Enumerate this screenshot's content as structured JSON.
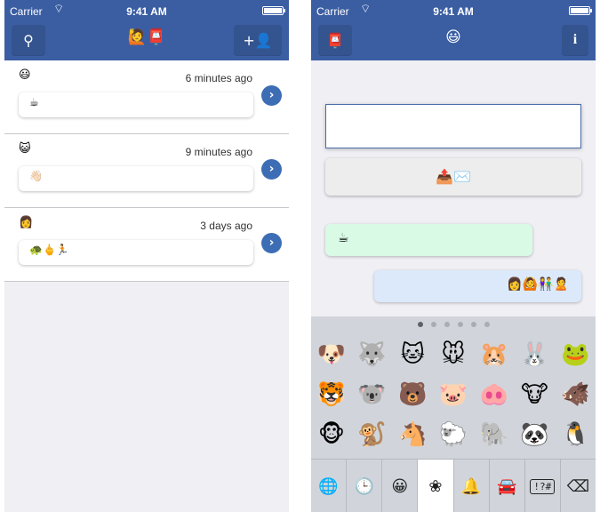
{
  "status_bar": {
    "carrier": "Carrier",
    "time": "9:41 AM"
  },
  "left_nav": {
    "tools_glyph": "⚲",
    "center_title": "🙋📮",
    "add_contact_glyph": "+👤"
  },
  "conversations": [
    {
      "avatar": "😃",
      "time": "6 minutes ago",
      "preview": "☕"
    },
    {
      "avatar": "😺",
      "time": "9 minutes ago",
      "preview": "👋🏻"
    },
    {
      "avatar": "👩",
      "time": "3 days ago",
      "preview": "🐢🖕🏃"
    }
  ],
  "chevron_glyph": "›",
  "right_nav": {
    "inbox_glyph": "📮",
    "center_title": "😃",
    "info_label": "i"
  },
  "compose": {
    "value": "",
    "placeholder": ""
  },
  "send_button_label": "📤✉️",
  "messages": [
    {
      "direction": "in",
      "text": "☕"
    },
    {
      "direction": "out",
      "text": "👩🙆👫🙎"
    }
  ],
  "keyboard": {
    "pages": 6,
    "active_page": 1,
    "emoji": [
      "🐶",
      "🐺",
      "🐱",
      "🐭",
      "🐹",
      "🐰",
      "🐸",
      "🐯",
      "🐨",
      "🐻",
      "🐷",
      "🐽",
      "🐮",
      "🐗",
      "🐵",
      "🐒",
      "🐴",
      "🐑",
      "🐘",
      "🐼",
      "🐧"
    ],
    "bar": [
      {
        "name": "globe",
        "glyph": "🌐"
      },
      {
        "name": "recent",
        "glyph": "🕒"
      },
      {
        "name": "smileys",
        "glyph": "😀"
      },
      {
        "name": "nature",
        "glyph": "❀"
      },
      {
        "name": "objects",
        "glyph": "🔔"
      },
      {
        "name": "places",
        "glyph": "🚘"
      },
      {
        "name": "symbols",
        "glyph": "!?#"
      },
      {
        "name": "delete",
        "glyph": "⌫"
      }
    ],
    "selected": "nature"
  },
  "colors": {
    "navbar": "#3b5ea3",
    "accent": "#3d6db5",
    "bubble_in": "#d9fbe6",
    "bubble_out": "#dbe9fb"
  }
}
